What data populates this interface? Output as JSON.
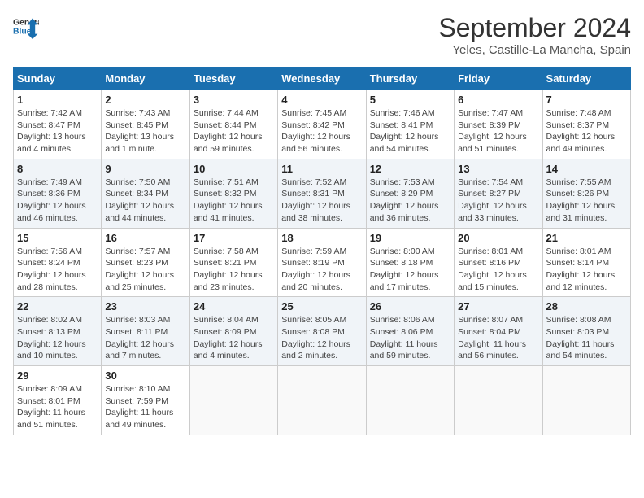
{
  "header": {
    "logo_general": "General",
    "logo_blue": "Blue",
    "month_title": "September 2024",
    "location": "Yeles, Castille-La Mancha, Spain"
  },
  "columns": [
    "Sunday",
    "Monday",
    "Tuesday",
    "Wednesday",
    "Thursday",
    "Friday",
    "Saturday"
  ],
  "weeks": [
    [
      {
        "day": "1",
        "sunrise": "Sunrise: 7:42 AM",
        "sunset": "Sunset: 8:47 PM",
        "daylight": "Daylight: 13 hours and 4 minutes."
      },
      {
        "day": "2",
        "sunrise": "Sunrise: 7:43 AM",
        "sunset": "Sunset: 8:45 PM",
        "daylight": "Daylight: 13 hours and 1 minute."
      },
      {
        "day": "3",
        "sunrise": "Sunrise: 7:44 AM",
        "sunset": "Sunset: 8:44 PM",
        "daylight": "Daylight: 12 hours and 59 minutes."
      },
      {
        "day": "4",
        "sunrise": "Sunrise: 7:45 AM",
        "sunset": "Sunset: 8:42 PM",
        "daylight": "Daylight: 12 hours and 56 minutes."
      },
      {
        "day": "5",
        "sunrise": "Sunrise: 7:46 AM",
        "sunset": "Sunset: 8:41 PM",
        "daylight": "Daylight: 12 hours and 54 minutes."
      },
      {
        "day": "6",
        "sunrise": "Sunrise: 7:47 AM",
        "sunset": "Sunset: 8:39 PM",
        "daylight": "Daylight: 12 hours and 51 minutes."
      },
      {
        "day": "7",
        "sunrise": "Sunrise: 7:48 AM",
        "sunset": "Sunset: 8:37 PM",
        "daylight": "Daylight: 12 hours and 49 minutes."
      }
    ],
    [
      {
        "day": "8",
        "sunrise": "Sunrise: 7:49 AM",
        "sunset": "Sunset: 8:36 PM",
        "daylight": "Daylight: 12 hours and 46 minutes."
      },
      {
        "day": "9",
        "sunrise": "Sunrise: 7:50 AM",
        "sunset": "Sunset: 8:34 PM",
        "daylight": "Daylight: 12 hours and 44 minutes."
      },
      {
        "day": "10",
        "sunrise": "Sunrise: 7:51 AM",
        "sunset": "Sunset: 8:32 PM",
        "daylight": "Daylight: 12 hours and 41 minutes."
      },
      {
        "day": "11",
        "sunrise": "Sunrise: 7:52 AM",
        "sunset": "Sunset: 8:31 PM",
        "daylight": "Daylight: 12 hours and 38 minutes."
      },
      {
        "day": "12",
        "sunrise": "Sunrise: 7:53 AM",
        "sunset": "Sunset: 8:29 PM",
        "daylight": "Daylight: 12 hours and 36 minutes."
      },
      {
        "day": "13",
        "sunrise": "Sunrise: 7:54 AM",
        "sunset": "Sunset: 8:27 PM",
        "daylight": "Daylight: 12 hours and 33 minutes."
      },
      {
        "day": "14",
        "sunrise": "Sunrise: 7:55 AM",
        "sunset": "Sunset: 8:26 PM",
        "daylight": "Daylight: 12 hours and 31 minutes."
      }
    ],
    [
      {
        "day": "15",
        "sunrise": "Sunrise: 7:56 AM",
        "sunset": "Sunset: 8:24 PM",
        "daylight": "Daylight: 12 hours and 28 minutes."
      },
      {
        "day": "16",
        "sunrise": "Sunrise: 7:57 AM",
        "sunset": "Sunset: 8:23 PM",
        "daylight": "Daylight: 12 hours and 25 minutes."
      },
      {
        "day": "17",
        "sunrise": "Sunrise: 7:58 AM",
        "sunset": "Sunset: 8:21 PM",
        "daylight": "Daylight: 12 hours and 23 minutes."
      },
      {
        "day": "18",
        "sunrise": "Sunrise: 7:59 AM",
        "sunset": "Sunset: 8:19 PM",
        "daylight": "Daylight: 12 hours and 20 minutes."
      },
      {
        "day": "19",
        "sunrise": "Sunrise: 8:00 AM",
        "sunset": "Sunset: 8:18 PM",
        "daylight": "Daylight: 12 hours and 17 minutes."
      },
      {
        "day": "20",
        "sunrise": "Sunrise: 8:01 AM",
        "sunset": "Sunset: 8:16 PM",
        "daylight": "Daylight: 12 hours and 15 minutes."
      },
      {
        "day": "21",
        "sunrise": "Sunrise: 8:01 AM",
        "sunset": "Sunset: 8:14 PM",
        "daylight": "Daylight: 12 hours and 12 minutes."
      }
    ],
    [
      {
        "day": "22",
        "sunrise": "Sunrise: 8:02 AM",
        "sunset": "Sunset: 8:13 PM",
        "daylight": "Daylight: 12 hours and 10 minutes."
      },
      {
        "day": "23",
        "sunrise": "Sunrise: 8:03 AM",
        "sunset": "Sunset: 8:11 PM",
        "daylight": "Daylight: 12 hours and 7 minutes."
      },
      {
        "day": "24",
        "sunrise": "Sunrise: 8:04 AM",
        "sunset": "Sunset: 8:09 PM",
        "daylight": "Daylight: 12 hours and 4 minutes."
      },
      {
        "day": "25",
        "sunrise": "Sunrise: 8:05 AM",
        "sunset": "Sunset: 8:08 PM",
        "daylight": "Daylight: 12 hours and 2 minutes."
      },
      {
        "day": "26",
        "sunrise": "Sunrise: 8:06 AM",
        "sunset": "Sunset: 8:06 PM",
        "daylight": "Daylight: 11 hours and 59 minutes."
      },
      {
        "day": "27",
        "sunrise": "Sunrise: 8:07 AM",
        "sunset": "Sunset: 8:04 PM",
        "daylight": "Daylight: 11 hours and 56 minutes."
      },
      {
        "day": "28",
        "sunrise": "Sunrise: 8:08 AM",
        "sunset": "Sunset: 8:03 PM",
        "daylight": "Daylight: 11 hours and 54 minutes."
      }
    ],
    [
      {
        "day": "29",
        "sunrise": "Sunrise: 8:09 AM",
        "sunset": "Sunset: 8:01 PM",
        "daylight": "Daylight: 11 hours and 51 minutes."
      },
      {
        "day": "30",
        "sunrise": "Sunrise: 8:10 AM",
        "sunset": "Sunset: 7:59 PM",
        "daylight": "Daylight: 11 hours and 49 minutes."
      },
      {
        "day": "",
        "sunrise": "",
        "sunset": "",
        "daylight": ""
      },
      {
        "day": "",
        "sunrise": "",
        "sunset": "",
        "daylight": ""
      },
      {
        "day": "",
        "sunrise": "",
        "sunset": "",
        "daylight": ""
      },
      {
        "day": "",
        "sunrise": "",
        "sunset": "",
        "daylight": ""
      },
      {
        "day": "",
        "sunrise": "",
        "sunset": "",
        "daylight": ""
      }
    ]
  ]
}
